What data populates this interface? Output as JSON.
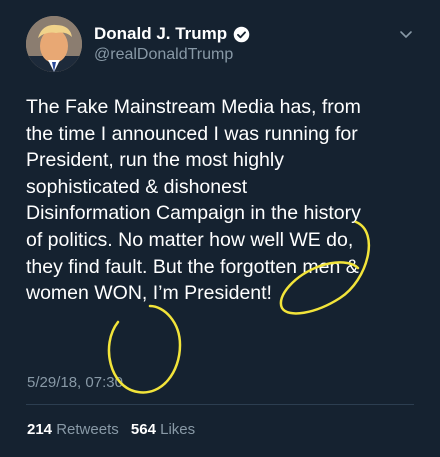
{
  "user": {
    "name": "Donald J. Trump",
    "handle": "@realDonaldTrump"
  },
  "tweet": {
    "text": "The Fake Mainstream Media has, from\nthe time I announced I was running for\nPresident, run the most highly\nsophisticated & dishonest\nDisinformation Campaign in the history\nof politics. No matter how well WE do,\nthey find fault. But the forgotten men &\nwomen WON, I’m President!",
    "timestamp": "5/29/18, 07:30"
  },
  "stats": {
    "retweets_count": "214",
    "retweets_label": "Retweets",
    "likes_count": "564",
    "likes_label": "Likes"
  },
  "icons": {
    "verified": "verified-badge-icon",
    "menu": "chevron-down-icon"
  },
  "colors": {
    "background": "#152230",
    "secondary_text": "#8899a6",
    "annotation": "#f2e43a"
  }
}
